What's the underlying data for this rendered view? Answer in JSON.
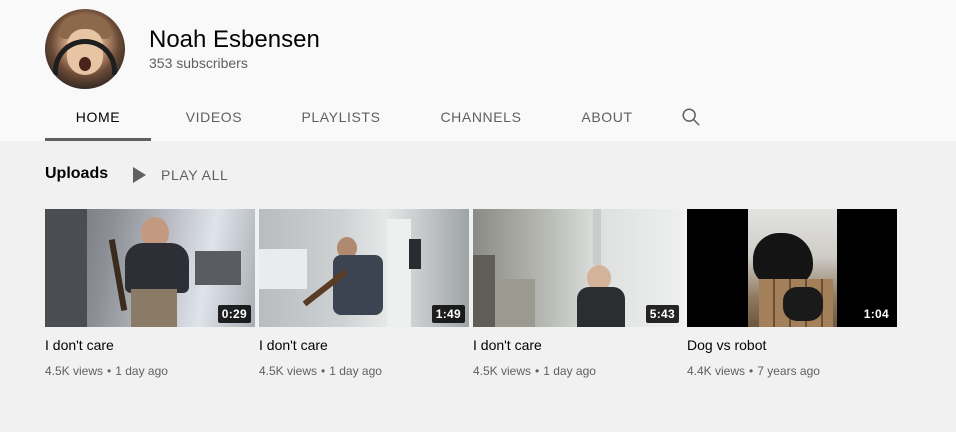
{
  "channel": {
    "name": "Noah Esbensen",
    "subscribers": "353 subscribers"
  },
  "tabs": [
    {
      "label": "HOME",
      "active": true
    },
    {
      "label": "VIDEOS",
      "active": false
    },
    {
      "label": "PLAYLISTS",
      "active": false
    },
    {
      "label": "CHANNELS",
      "active": false
    },
    {
      "label": "ABOUT",
      "active": false
    }
  ],
  "search_icon": "search-icon",
  "uploads": {
    "title": "Uploads",
    "play_all_label": "PLAY ALL",
    "videos": [
      {
        "title": "I don't care",
        "duration": "0:29",
        "views": "4.5K views",
        "age": "1 day ago"
      },
      {
        "title": "I don't care",
        "duration": "1:49",
        "views": "4.5K views",
        "age": "1 day ago"
      },
      {
        "title": "I don't care",
        "duration": "5:43",
        "views": "4.5K views",
        "age": "1 day ago"
      },
      {
        "title": "Dog vs robot",
        "duration": "1:04",
        "views": "4.4K views",
        "age": "7 years ago"
      }
    ]
  },
  "colors": {
    "page_bg": "#f1f1f1",
    "header_bg": "#f9f9f9",
    "text_primary": "#030303",
    "text_secondary": "#606060"
  }
}
